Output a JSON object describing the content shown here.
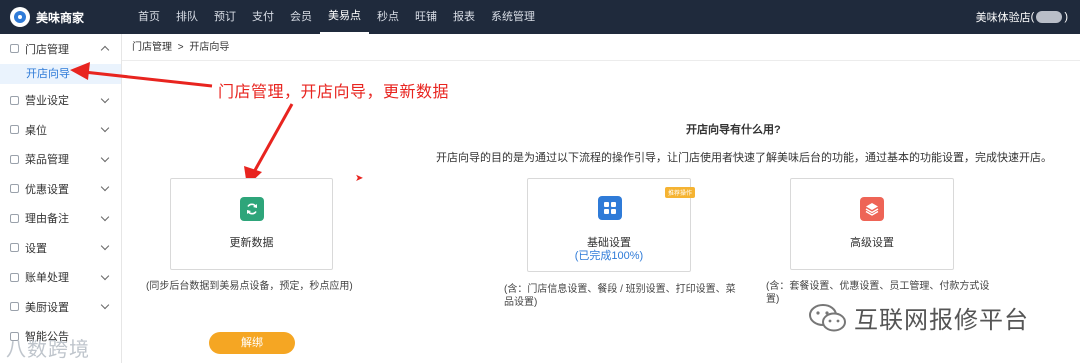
{
  "brand": {
    "name": "美味商家"
  },
  "nav": {
    "items": [
      "首页",
      "排队",
      "预订",
      "支付",
      "会员",
      "美易点",
      "秒点",
      "旺铺",
      "报表",
      "系统管理"
    ],
    "active_index": 5
  },
  "store": {
    "name": "美味体验店",
    "paren_open": "(",
    "paren_close": ")"
  },
  "sidebar": {
    "groups": [
      {
        "label": "门店管理",
        "expanded": true
      },
      {
        "label": "营业设定"
      },
      {
        "label": "桌位"
      },
      {
        "label": "菜品管理"
      },
      {
        "label": "优惠设置"
      },
      {
        "label": "理由备注"
      },
      {
        "label": "设置"
      },
      {
        "label": "账单处理"
      },
      {
        "label": "美厨设置"
      },
      {
        "label": "智能公告"
      }
    ],
    "active_sub": "开店向导"
  },
  "breadcrumb": {
    "parent": "门店管理",
    "sep": ">",
    "current": "开店向导"
  },
  "annotation": "门店管理，开店向导，更新数据",
  "help": {
    "title": "开店向导有什么用?",
    "description": "开店向导的目的是为通过以下流程的操作引导，让门店使用者快速了解美味后台的功能，通过基本的功能设置，完成快速开店。"
  },
  "cards": {
    "update": {
      "title": "更新数据",
      "note": "(同步后台数据到美易点设备，预定，秒点应用)"
    },
    "basic": {
      "title": "基础设置",
      "status": "(已完成100%)",
      "badge": "推荐操作",
      "note": "(含：门店信息设置、餐段 / 班别设置、打印设置、菜品设置)"
    },
    "advanced": {
      "title": "高级设置",
      "note": "(含：套餐设置、优惠设置、员工管理、付款方式设置)"
    }
  },
  "unbind_button": "解绑",
  "watermarks": {
    "left": "八数跨境",
    "right": "互联网报修平台"
  },
  "colors": {
    "topbar": "#1f2a3c",
    "accent": "#2f7bd8",
    "annotation": "#e8241f",
    "green": "#2ea57a",
    "blue": "#2f7bd8",
    "red": "#ee6456",
    "orange": "#f5a623"
  }
}
